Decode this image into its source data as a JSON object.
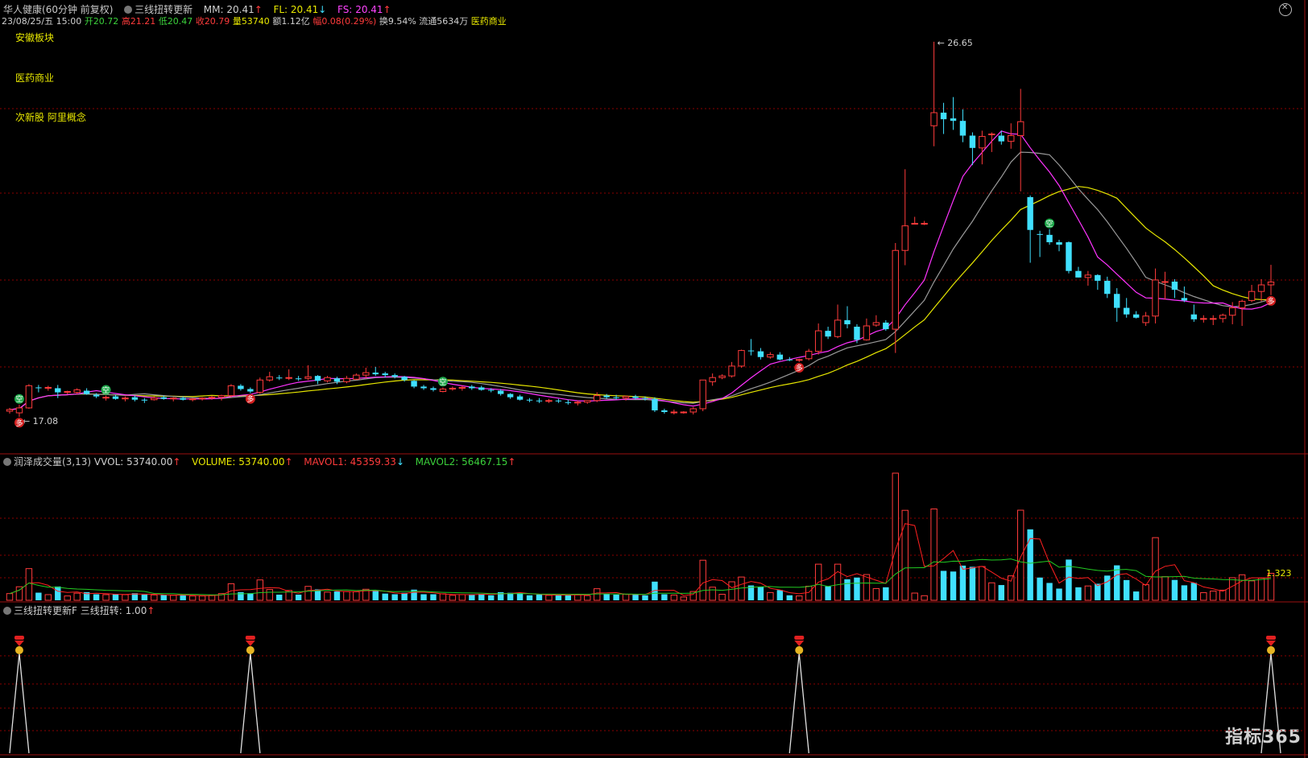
{
  "header": {
    "stock_name": "华人健康",
    "period": "(60分钟 前复权)",
    "indicator_name": "三线扭转更新",
    "mm_label": "MM:",
    "mm_value": "20.41",
    "fl_label": "FL:",
    "fl_value": "20.41",
    "fs_label": "FS:",
    "fs_value": "20.41",
    "date": "23/08/25/五 15:00",
    "open_label": "开",
    "open": "20.72",
    "high_label": "高",
    "high": "21.21",
    "low_label": "低",
    "low": "20.47",
    "close_label": "收",
    "close": "20.79",
    "volume_label": "量",
    "volume": "53740",
    "amount_label": "额",
    "amount": "1.12亿",
    "change_label": "幅",
    "change": "0.08(0.29%)",
    "turnover_label": "换",
    "turnover": "9.54%",
    "float_label": "流通",
    "float": "5634万",
    "sector": "医药商业"
  },
  "tags": [
    "安徽板块",
    "医药商业",
    "次新股 阿里概念"
  ],
  "price_labels": {
    "high_mark": "26.65",
    "low_mark": "17.08"
  },
  "volume_panel": {
    "title": "润泽成交量(3,13)",
    "vvol_label": "VVOL:",
    "vvol": "53740.00",
    "volume_label": "VOLUME:",
    "volume": "53740.00",
    "mavol1_label": "MAVOL1:",
    "mavol1": "45359.33",
    "mavol2_label": "MAVOL2:",
    "mavol2": "56467.15",
    "ratio_label": "1.323"
  },
  "signal_panel": {
    "title": "三线扭转更新F",
    "value_label": "三线扭转:",
    "value": "1.00"
  },
  "brand": "指标365",
  "colors": {
    "up": "#ff3b3b",
    "down": "#40e0ff",
    "grid": "#8b0000",
    "ma_yellow": "#e8e800",
    "ma_magenta": "#ff33ff",
    "ma_gray": "#9a9a9a",
    "mavol1": "#ff2020",
    "mavol2": "#22cc22"
  },
  "chart_data": {
    "type": "candlestick",
    "ylim": [
      16.6,
      27.0
    ],
    "candles": [
      [
        17.64,
        17.72,
        17.58,
        17.68
      ],
      [
        17.6,
        17.8,
        17.5,
        17.72
      ],
      [
        17.72,
        18.3,
        17.7,
        18.26
      ],
      [
        18.22,
        18.28,
        18.1,
        18.2
      ],
      [
        18.2,
        18.26,
        18.14,
        18.22
      ],
      [
        18.2,
        18.28,
        17.96,
        18.1
      ],
      [
        18.1,
        18.14,
        18.06,
        18.12
      ],
      [
        18.1,
        18.2,
        18.06,
        18.16
      ],
      [
        18.14,
        18.2,
        18.04,
        18.06
      ],
      [
        18.04,
        18.08,
        17.96,
        18.0
      ],
      [
        17.96,
        18.02,
        17.9,
        17.98
      ],
      [
        18.0,
        18.04,
        17.92,
        17.94
      ],
      [
        17.94,
        18.0,
        17.88,
        17.96
      ],
      [
        17.98,
        18.02,
        17.88,
        17.92
      ],
      [
        17.92,
        17.96,
        17.84,
        17.9
      ],
      [
        17.92,
        18.0,
        17.9,
        17.96
      ],
      [
        17.98,
        18.02,
        17.92,
        17.94
      ],
      [
        17.94,
        17.98,
        17.88,
        17.96
      ],
      [
        17.96,
        18.0,
        17.9,
        17.92
      ],
      [
        17.92,
        17.96,
        17.88,
        17.94
      ],
      [
        17.94,
        17.98,
        17.9,
        17.96
      ],
      [
        17.96,
        18.02,
        17.92,
        17.98
      ],
      [
        17.98,
        18.04,
        17.9,
        18.02
      ],
      [
        18.02,
        18.3,
        17.98,
        18.26
      ],
      [
        18.26,
        18.3,
        18.14,
        18.18
      ],
      [
        18.18,
        18.22,
        18.08,
        18.12
      ],
      [
        18.1,
        18.46,
        18.06,
        18.4
      ],
      [
        18.4,
        18.6,
        18.36,
        18.48
      ],
      [
        18.46,
        18.52,
        18.4,
        18.44
      ],
      [
        18.46,
        18.66,
        18.4,
        18.46
      ],
      [
        18.44,
        18.5,
        18.38,
        18.42
      ],
      [
        18.44,
        18.76,
        18.4,
        18.48
      ],
      [
        18.5,
        18.52,
        18.3,
        18.38
      ],
      [
        18.38,
        18.5,
        18.34,
        18.46
      ],
      [
        18.44,
        18.48,
        18.3,
        18.36
      ],
      [
        18.36,
        18.5,
        18.32,
        18.44
      ],
      [
        18.42,
        18.56,
        18.4,
        18.52
      ],
      [
        18.52,
        18.7,
        18.44,
        18.58
      ],
      [
        18.58,
        18.72,
        18.5,
        18.54
      ],
      [
        18.56,
        18.6,
        18.46,
        18.52
      ],
      [
        18.52,
        18.56,
        18.44,
        18.48
      ],
      [
        18.48,
        18.5,
        18.36,
        18.4
      ],
      [
        18.38,
        18.4,
        18.2,
        18.24
      ],
      [
        18.24,
        18.28,
        18.16,
        18.2
      ],
      [
        18.2,
        18.24,
        18.12,
        18.16
      ],
      [
        18.12,
        18.22,
        18.1,
        18.18
      ],
      [
        18.18,
        18.24,
        18.14,
        18.2
      ],
      [
        18.2,
        18.26,
        18.14,
        18.22
      ],
      [
        18.24,
        18.28,
        18.16,
        18.2
      ],
      [
        18.22,
        18.26,
        18.14,
        18.16
      ],
      [
        18.16,
        18.2,
        18.1,
        18.14
      ],
      [
        18.14,
        18.18,
        18.02,
        18.06
      ],
      [
        18.06,
        18.08,
        17.94,
        17.98
      ],
      [
        18.0,
        18.04,
        17.9,
        17.92
      ],
      [
        17.92,
        17.96,
        17.86,
        17.9
      ],
      [
        17.9,
        17.96,
        17.84,
        17.88
      ],
      [
        17.88,
        17.94,
        17.84,
        17.9
      ],
      [
        17.9,
        17.94,
        17.84,
        17.88
      ],
      [
        17.86,
        17.92,
        17.8,
        17.84
      ],
      [
        17.84,
        17.9,
        17.78,
        17.86
      ],
      [
        17.86,
        17.9,
        17.82,
        17.9
      ],
      [
        17.9,
        18.1,
        17.86,
        18.02
      ],
      [
        18.02,
        18.06,
        17.94,
        17.98
      ],
      [
        17.98,
        18.04,
        17.92,
        17.96
      ],
      [
        17.96,
        18.02,
        17.9,
        18.0
      ],
      [
        18.0,
        18.04,
        17.92,
        17.96
      ],
      [
        17.96,
        18.0,
        17.9,
        17.94
      ],
      [
        17.94,
        17.98,
        17.62,
        17.66
      ],
      [
        17.66,
        17.7,
        17.58,
        17.62
      ],
      [
        17.62,
        17.68,
        17.56,
        17.62
      ],
      [
        17.62,
        17.64,
        17.58,
        17.62
      ],
      [
        17.62,
        17.74,
        17.56,
        17.7
      ],
      [
        17.7,
        18.4,
        17.64,
        18.4
      ],
      [
        18.36,
        18.56,
        18.26,
        18.46
      ],
      [
        18.46,
        18.54,
        18.42,
        18.5
      ],
      [
        18.5,
        18.84,
        18.46,
        18.74
      ],
      [
        18.74,
        19.14,
        18.7,
        19.12
      ],
      [
        19.12,
        19.4,
        19.0,
        19.1
      ],
      [
        19.1,
        19.18,
        18.9,
        18.96
      ],
      [
        18.96,
        19.08,
        18.92,
        19.02
      ],
      [
        19.02,
        19.08,
        18.88,
        18.9
      ],
      [
        18.9,
        18.96,
        18.86,
        18.88
      ],
      [
        18.88,
        18.92,
        18.84,
        18.9
      ],
      [
        18.92,
        19.16,
        18.88,
        19.1
      ],
      [
        19.1,
        19.78,
        19.02,
        19.6
      ],
      [
        19.6,
        19.7,
        19.4,
        19.46
      ],
      [
        19.46,
        20.24,
        19.42,
        19.86
      ],
      [
        19.86,
        20.2,
        19.66,
        19.76
      ],
      [
        19.7,
        19.76,
        19.3,
        19.38
      ],
      [
        19.38,
        19.9,
        19.36,
        19.72
      ],
      [
        19.74,
        19.98,
        19.7,
        19.8
      ],
      [
        19.8,
        19.86,
        19.6,
        19.64
      ],
      [
        19.64,
        21.74,
        19.06,
        21.56
      ],
      [
        21.56,
        23.54,
        21.2,
        22.16
      ],
      [
        22.22,
        22.38,
        22.2,
        22.22
      ],
      [
        22.22,
        22.28,
        22.18,
        22.22
      ],
      [
        24.6,
        26.65,
        24.1,
        24.92
      ],
      [
        24.92,
        25.16,
        24.4,
        24.76
      ],
      [
        24.78,
        25.3,
        24.5,
        24.72
      ],
      [
        24.72,
        25.0,
        24.2,
        24.36
      ],
      [
        24.36,
        24.44,
        23.64,
        24.06
      ],
      [
        24.06,
        24.48,
        23.66,
        24.34
      ],
      [
        24.38,
        24.44,
        23.96,
        24.4
      ],
      [
        24.36,
        24.48,
        24.14,
        24.22
      ],
      [
        24.22,
        24.66,
        24.04,
        24.36
      ],
      [
        24.36,
        25.5,
        23.0,
        24.7
      ],
      [
        22.86,
        22.9,
        21.26,
        22.06
      ],
      [
        21.96,
        22.04,
        21.4,
        21.94
      ],
      [
        21.94,
        22.08,
        21.7,
        21.76
      ],
      [
        21.76,
        21.82,
        21.54,
        21.7
      ],
      [
        21.76,
        21.78,
        21.0,
        21.06
      ],
      [
        21.06,
        21.16,
        20.9,
        20.9
      ],
      [
        20.9,
        21.06,
        20.7,
        20.96
      ],
      [
        20.96,
        20.98,
        20.6,
        20.82
      ],
      [
        20.82,
        20.92,
        20.4,
        20.5
      ],
      [
        20.5,
        20.64,
        19.82,
        20.16
      ],
      [
        20.16,
        20.4,
        19.92,
        20.0
      ],
      [
        20.0,
        20.08,
        19.9,
        19.92
      ],
      [
        19.8,
        20.06,
        19.72,
        19.96
      ],
      [
        19.96,
        21.12,
        19.78,
        20.84
      ],
      [
        20.8,
        21.04,
        20.36,
        20.8
      ],
      [
        20.8,
        20.86,
        20.4,
        20.6
      ],
      [
        20.4,
        20.68,
        20.3,
        20.34
      ],
      [
        20.0,
        20.24,
        19.82,
        19.88
      ],
      [
        19.88,
        19.98,
        19.8,
        19.9
      ],
      [
        19.9,
        19.98,
        19.74,
        19.9
      ],
      [
        19.9,
        20.02,
        19.8,
        19.98
      ],
      [
        19.98,
        20.3,
        19.76,
        20.16
      ],
      [
        20.16,
        20.36,
        19.72,
        20.32
      ],
      [
        20.34,
        20.72,
        20.3,
        20.56
      ],
      [
        20.56,
        20.86,
        20.32,
        20.72
      ],
      [
        20.72,
        21.21,
        20.47,
        20.79
      ]
    ],
    "ma_yellow": [],
    "volume": []
  }
}
